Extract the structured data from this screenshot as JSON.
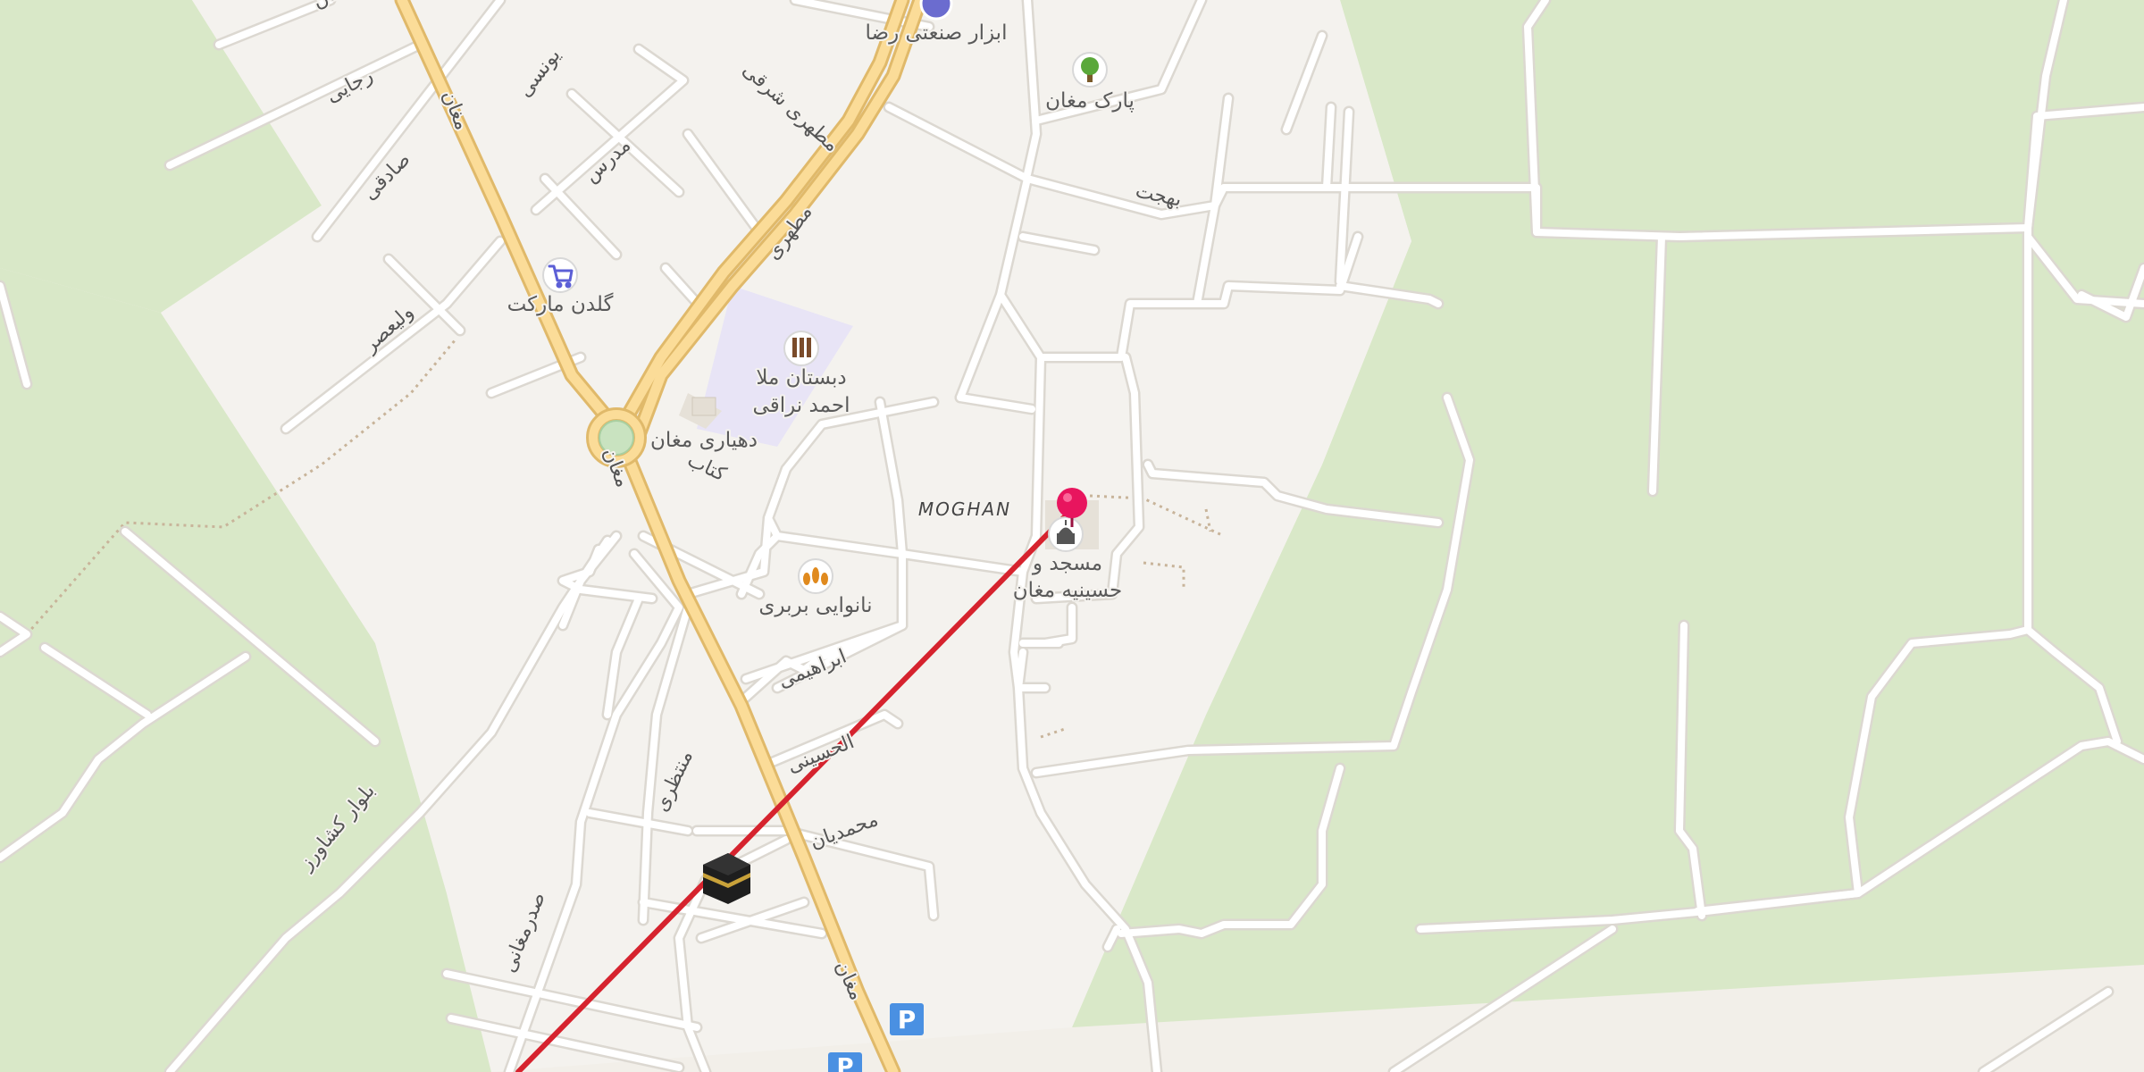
{
  "map": {
    "town_label": "MOGHAN",
    "streets": {
      "maghan_1": "مغان",
      "maghan_2": "مغان",
      "maghan_3": "مغان",
      "rajaei": "رجایی",
      "sadeghi": "صادقی",
      "yonesi": "یونسی",
      "modarres": "مدرس",
      "motahari_1": "مطهری شرقی",
      "motahari_2": "مطهری",
      "valiasr": "ولیعصر",
      "ketab": "کتاب",
      "bahjat": "بهجت",
      "ebrahimi": "ابراهیمی",
      "alhosseini": "الحسینی",
      "mohammadian": "محمدیان",
      "montazeri": "منتظری",
      "sadr": "صدرمغانی",
      "boulevard": "بلوار کشاورز",
      "top_left": "دهقان"
    },
    "pois": [
      {
        "name": "ابزار صنعتی رضا",
        "icon": "hardware-store-icon"
      },
      {
        "name": "پارک مغان",
        "icon": "tree-park-icon"
      },
      {
        "name": "گلدن مارکت",
        "icon": "shopping-cart-icon"
      },
      {
        "name": "دبستان ملا احمد نراقی",
        "icon": "school-icon"
      },
      {
        "name": "دهیاری مغان",
        "icon": "building-icon"
      },
      {
        "name": "نانوایی بربری",
        "icon": "bakery-icon"
      },
      {
        "name": "مسجد و حسینیه مغان",
        "icon": "mosque-icon"
      }
    ],
    "school_lines": [
      "دبستان ملا",
      "احمد نراقی"
    ],
    "mosque_lines": [
      "مسجد و",
      "حسینیه مغان"
    ],
    "parking_symbol": "P",
    "colors": {
      "land": "#f2efe9",
      "green_area": "#d9e8c8",
      "school_area": "#e8e4f6",
      "main_road": "#fbdc98",
      "qibla_line": "#d6232e",
      "pin": "#e8155e",
      "parking": "#4a90e2"
    },
    "markers": [
      "location-pin-icon",
      "kaaba-icon"
    ]
  }
}
